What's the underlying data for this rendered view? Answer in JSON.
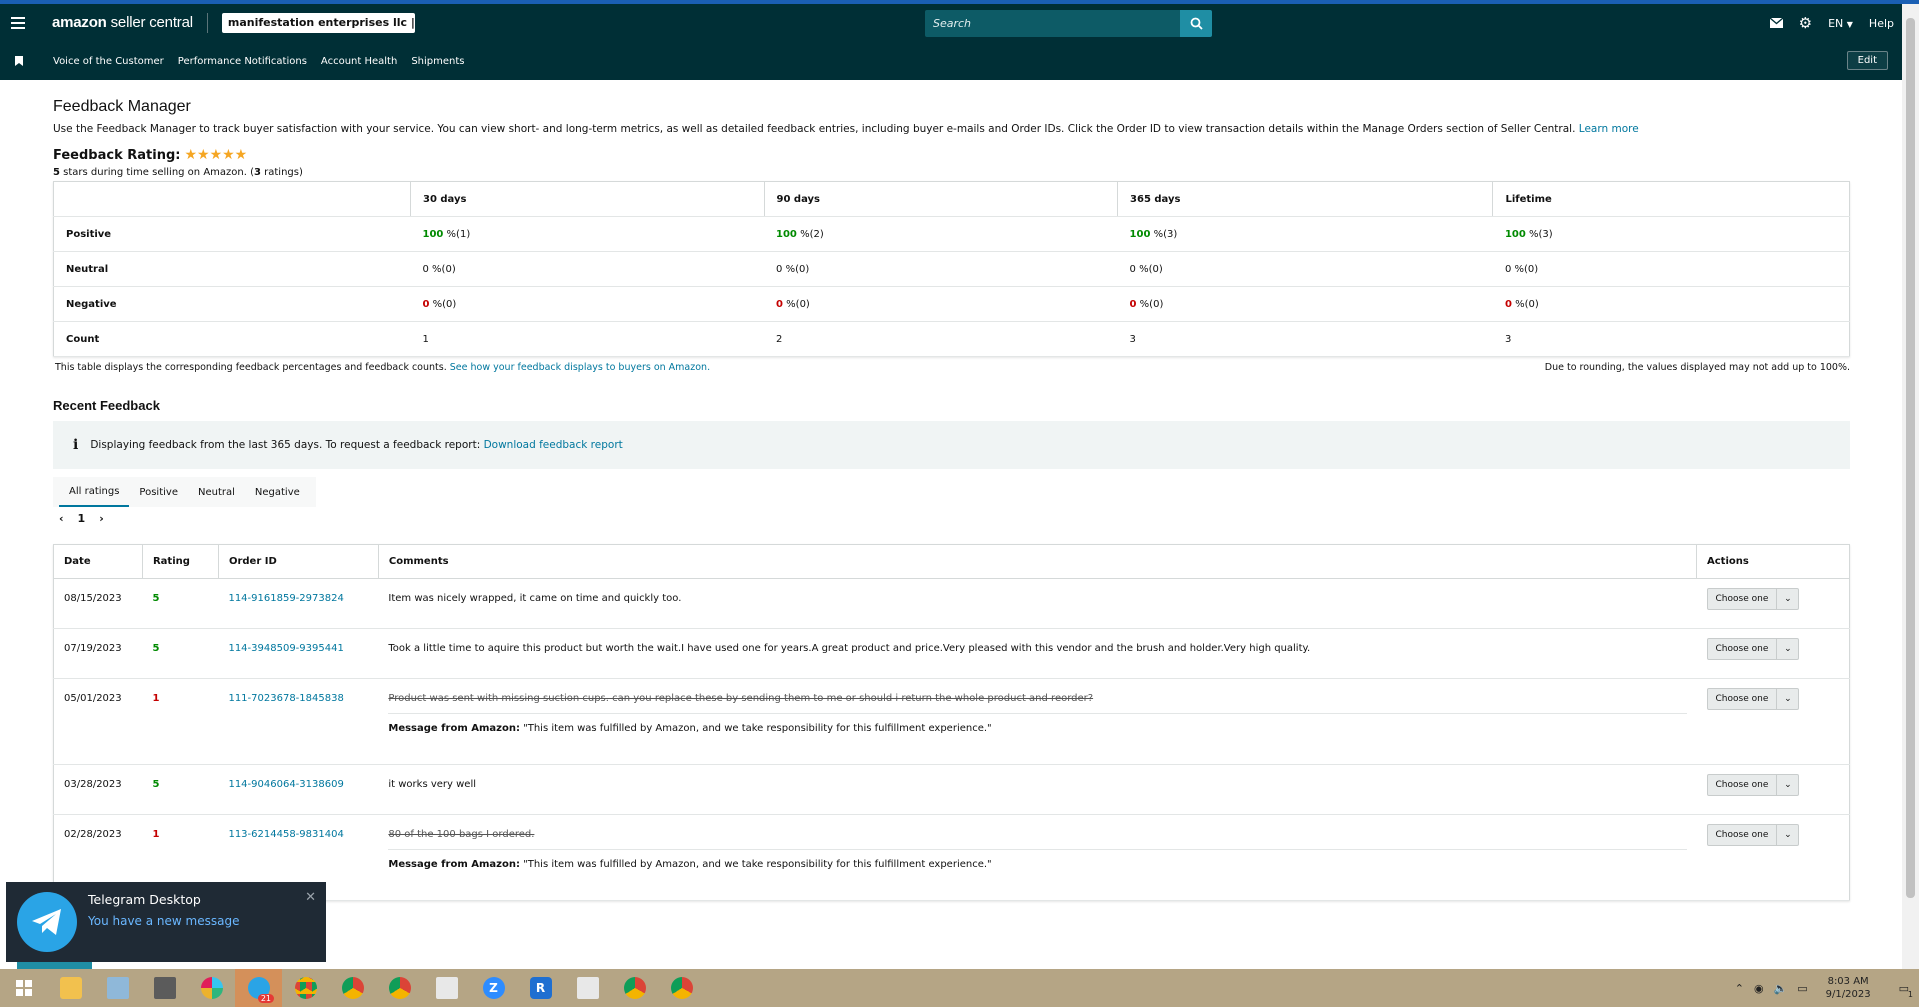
{
  "header": {
    "logo_main": "amazon",
    "logo_sub": "seller central",
    "store_name": "manifestation enterprises llc | ...",
    "search_placeholder": "Search",
    "language": "EN",
    "help": "Help"
  },
  "nav": {
    "items": [
      "Voice of the Customer",
      "Performance Notifications",
      "Account Health",
      "Shipments"
    ],
    "edit": "Edit"
  },
  "page": {
    "title": "Feedback Manager",
    "intro": "Use the Feedback Manager to track buyer satisfaction with your service. You can view short- and long-term metrics, as well as detailed feedback entries, including buyer e-mails and Order IDs. Click the Order ID to view transaction details within the Manage Orders section of Seller Central.",
    "learn_more": "Learn more",
    "rating_label": "Feedback Rating:",
    "rating_stars": "★★★★★",
    "rating_value": 5,
    "rating_sub_prefix": "5",
    "rating_sub_mid": " stars during time selling on Amazon. (",
    "rating_sub_count": "3",
    "rating_sub_suffix": " ratings)"
  },
  "summary": {
    "headers": [
      "30 days",
      "90 days",
      "365 days",
      "Lifetime"
    ],
    "rows": [
      {
        "label": "Positive",
        "cells": [
          {
            "pct": "100",
            "cnt": " %(1)"
          },
          {
            "pct": "100",
            "cnt": " %(2)"
          },
          {
            "pct": "100",
            "cnt": " %(3)"
          },
          {
            "pct": "100",
            "cnt": " %(3)"
          }
        ]
      },
      {
        "label": "Neutral",
        "cells": [
          {
            "pct": "0",
            "cnt": " %(0)"
          },
          {
            "pct": "0",
            "cnt": " %(0)"
          },
          {
            "pct": "0",
            "cnt": " %(0)"
          },
          {
            "pct": "0",
            "cnt": " %(0)"
          }
        ]
      },
      {
        "label": "Negative",
        "cells": [
          {
            "pct": "0",
            "cnt": " %(0)"
          },
          {
            "pct": "0",
            "cnt": " %(0)"
          },
          {
            "pct": "0",
            "cnt": " %(0)"
          },
          {
            "pct": "0",
            "cnt": " %(0)"
          }
        ]
      },
      {
        "label": "Count",
        "cells": [
          {
            "pct": "1",
            "cnt": ""
          },
          {
            "pct": "2",
            "cnt": ""
          },
          {
            "pct": "3",
            "cnt": ""
          },
          {
            "pct": "3",
            "cnt": ""
          }
        ]
      }
    ],
    "footnote": "This table displays the corresponding feedback percentages and feedback counts.",
    "footnote_link": "See how your feedback displays to buyers on Amazon.",
    "rounding_note": "Due to rounding, the values displayed may not add up to 100%."
  },
  "recent": {
    "title": "Recent Feedback",
    "info_icon": "i",
    "info_text": "Displaying feedback from the last 365 days. To request a feedback report:",
    "info_link": "Download feedback report",
    "tabs": [
      "All ratings",
      "Positive",
      "Neutral",
      "Negative"
    ],
    "page": "1",
    "columns": [
      "Date",
      "Rating",
      "Order ID",
      "Comments",
      "Actions"
    ],
    "action_label": "Choose one",
    "message_prefix": "Message from Amazon:",
    "message_text": " \"This item was fulfilled by Amazon, and we take responsibility for this fulfillment experience.\"",
    "rows": [
      {
        "date": "08/15/2023",
        "rating": "5",
        "order": "114-9161859-2973824",
        "comment": "Item was nicely wrapped, it came on time and quickly too.",
        "struck": false,
        "message": false
      },
      {
        "date": "07/19/2023",
        "rating": "5",
        "order": "114-3948509-9395441",
        "comment": "Took a little time to aquire this product but worth the wait.I have used one for years.A great product and price.Very pleased with this vendor and the brush and holder.Very high quality.",
        "struck": false,
        "message": false
      },
      {
        "date": "05/01/2023",
        "rating": "1",
        "order": "111-7023678-1845838",
        "comment": "Product was sent with missing suction cups. can you replace these by sending them to me or should i return the whole product and reorder?",
        "struck": true,
        "message": true
      },
      {
        "date": "03/28/2023",
        "rating": "5",
        "order": "114-9046064-3138609",
        "comment": "it works very well",
        "struck": false,
        "message": false
      },
      {
        "date": "02/28/2023",
        "rating": "1",
        "order": "113-6214458-9831404",
        "comment": "80 of the 100 bags I ordered.",
        "struck": true,
        "message": true
      }
    ]
  },
  "toast": {
    "title": "Telegram Desktop",
    "message": "You have a new message"
  },
  "taskbar": {
    "time": "8:03 AM",
    "date": "9/1/2023",
    "telegram_badge": "21",
    "notification_count": "1"
  },
  "colors": {
    "header_bg": "#002f36",
    "link": "#00779e",
    "positive": "#008a00",
    "negative": "#c40000",
    "star": "#f5a623",
    "taskbar": "#b5a585"
  }
}
